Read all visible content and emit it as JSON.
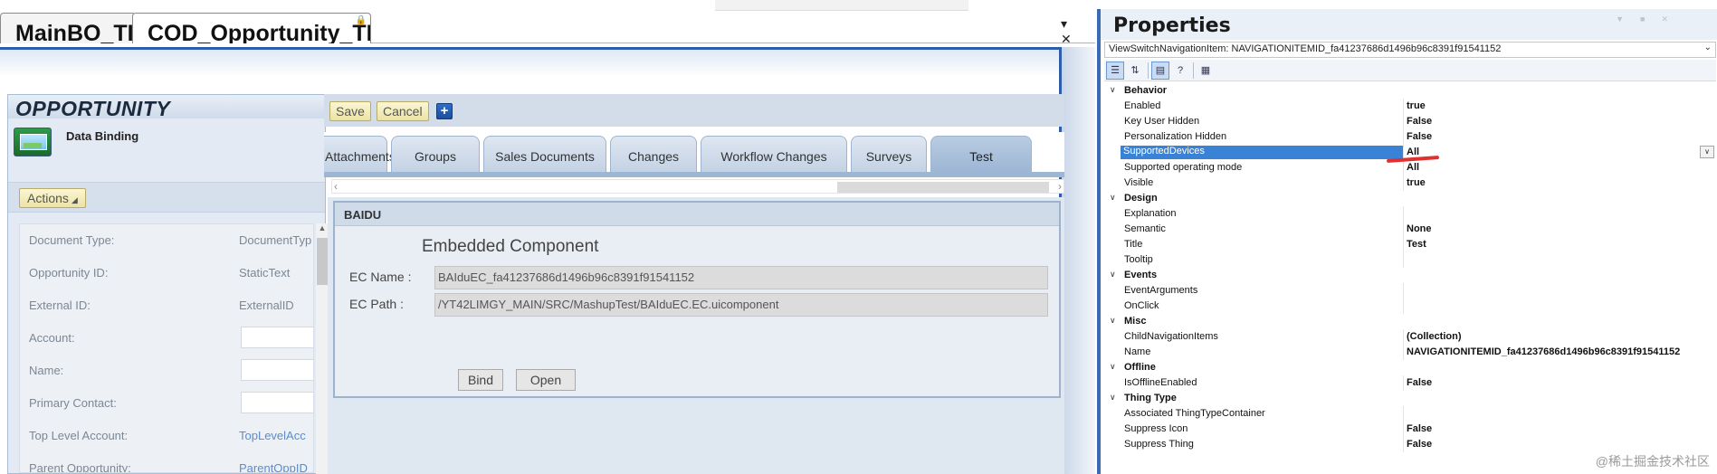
{
  "doc_tabs": [
    {
      "label": "MainBO_TI"
    },
    {
      "label": "COD_Opportunity_TI"
    }
  ],
  "left_panel": {
    "title": "OPPORTUNITY",
    "subtitle": "Data Binding",
    "actions_label": "Actions",
    "fields": [
      {
        "label": "Document Type:",
        "value": "DocumentTyp",
        "kind": "text"
      },
      {
        "label": "Opportunity ID:",
        "value": "StaticText",
        "kind": "text"
      },
      {
        "label": "External ID:",
        "value": "ExternalID",
        "kind": "text"
      },
      {
        "label": "Account:",
        "value": "",
        "kind": "input"
      },
      {
        "label": "Name:",
        "value": "",
        "kind": "input"
      },
      {
        "label": "Primary Contact:",
        "value": "",
        "kind": "input"
      },
      {
        "label": "Top Level Account:",
        "value": "TopLevelAcc",
        "kind": "link"
      },
      {
        "label": "Parent Opportunity:",
        "value": "ParentOppID",
        "kind": "link"
      }
    ]
  },
  "toolbar": {
    "save_label": "Save",
    "cancel_label": "Cancel",
    "plus_label": "+"
  },
  "tabs": [
    {
      "label": "Attachments"
    },
    {
      "label": "Groups"
    },
    {
      "label": "Sales Documents"
    },
    {
      "label": "Changes"
    },
    {
      "label": "Workflow Changes"
    },
    {
      "label": "Surveys"
    },
    {
      "label": "Test",
      "active": true
    }
  ],
  "group": {
    "title": "BAIDU",
    "heading": "Embedded Component",
    "ec_name_label": "EC Name :",
    "ec_name_value": "BAIduEC_fa41237686d1496b96c8391f91541152",
    "ec_path_label": "EC Path :",
    "ec_path_value": "/YT42LIMGY_MAIN/SRC/MashupTest/BAIduEC.EC.uicomponent",
    "bind_label": "Bind",
    "open_label": "Open"
  },
  "properties": {
    "title": "Properties",
    "object": "ViewSwitchNavigationItem: NAVIGATIONITEMID_fa41237686d1496b96c8391f91541152",
    "rows": [
      {
        "type": "cat",
        "name": "Behavior"
      },
      {
        "type": "prop",
        "name": "Enabled",
        "value": "true"
      },
      {
        "type": "prop",
        "name": "Key User Hidden",
        "value": "False"
      },
      {
        "type": "prop",
        "name": "Personalization Hidden",
        "value": "False"
      },
      {
        "type": "prop",
        "name": "SupportedDevices",
        "value": "All",
        "selected": true
      },
      {
        "type": "prop",
        "name": "Supported operating mode",
        "value": "All"
      },
      {
        "type": "prop",
        "name": "Visible",
        "value": "true"
      },
      {
        "type": "cat",
        "name": "Design"
      },
      {
        "type": "prop",
        "name": "Explanation",
        "value": ""
      },
      {
        "type": "prop",
        "name": "Semantic",
        "value": "None"
      },
      {
        "type": "prop",
        "name": "Title",
        "value": "Test"
      },
      {
        "type": "prop",
        "name": "Tooltip",
        "value": ""
      },
      {
        "type": "cat",
        "name": "Events"
      },
      {
        "type": "prop",
        "name": "EventArguments",
        "value": ""
      },
      {
        "type": "prop",
        "name": "OnClick",
        "value": ""
      },
      {
        "type": "cat",
        "name": "Misc"
      },
      {
        "type": "prop",
        "name": "ChildNavigationItems",
        "value": "(Collection)"
      },
      {
        "type": "prop",
        "name": "Name",
        "value": "NAVIGATIONITEMID_fa41237686d1496b96c8391f91541152"
      },
      {
        "type": "cat",
        "name": "Offline"
      },
      {
        "type": "prop",
        "name": "IsOfflineEnabled",
        "value": "False"
      },
      {
        "type": "cat",
        "name": "Thing Type"
      },
      {
        "type": "prop",
        "name": "Associated ThingTypeContainer",
        "value": ""
      },
      {
        "type": "prop",
        "name": "Suppress Icon",
        "value": "False"
      },
      {
        "type": "prop",
        "name": "Suppress Thing",
        "value": "False"
      }
    ]
  },
  "watermark": "@稀土掘金技术社区"
}
